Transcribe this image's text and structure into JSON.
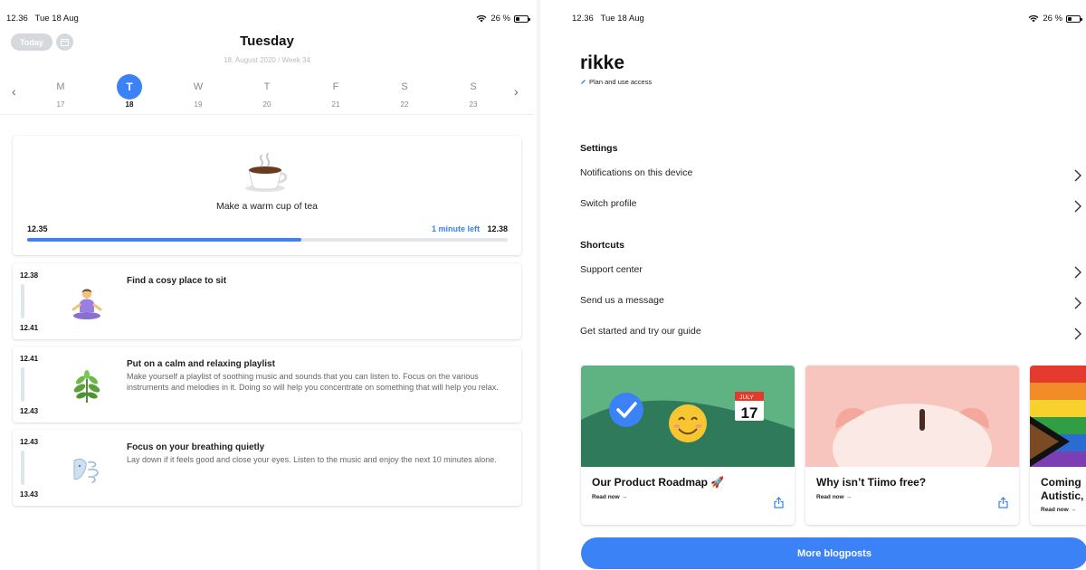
{
  "status_left": {
    "time": "12.36",
    "date": "Tue 18 Aug",
    "battery": "26 %"
  },
  "status_right": {
    "time": "12.36",
    "date": "Tue 18 Aug",
    "battery": "26 %"
  },
  "calendar": {
    "today_label": "Today",
    "day_title": "Tuesday",
    "day_subtitle": "18. August 2020 / Week 34",
    "week": [
      {
        "letter": "M",
        "num": "17"
      },
      {
        "letter": "T",
        "num": "18"
      },
      {
        "letter": "W",
        "num": "19"
      },
      {
        "letter": "T",
        "num": "20"
      },
      {
        "letter": "F",
        "num": "21"
      },
      {
        "letter": "S",
        "num": "22"
      },
      {
        "letter": "S",
        "num": "23"
      }
    ],
    "selected_index": 1
  },
  "current_activity": {
    "icon": "hot-beverage-icon",
    "title": "Make a warm cup of tea",
    "start": "12.35",
    "time_left": "1 minute left",
    "end": "12.38",
    "progress": 0.57
  },
  "activities": [
    {
      "start": "12.38",
      "end": "12.41",
      "icon": "meditation-icon",
      "title": "Find a cosy place to sit",
      "description": ""
    },
    {
      "start": "12.41",
      "end": "12.43",
      "icon": "herb-icon",
      "title": "Put on a calm and relaxing playlist",
      "description": "Make yourself a playlist of soothing music and sounds that you can listen to. Focus on the various instruments and melodies in it. Doing so will help you concentrate on something that will help you relax."
    },
    {
      "start": "12.43",
      "end": "13.43",
      "icon": "wind-face-icon",
      "title": "Focus on your breathing quietly",
      "description": "Lay down if it feels good and close your eyes. Listen to the music and enjoy the next 10 minutes alone."
    }
  ],
  "profile": {
    "name": "rikke",
    "subtitle": "Plan and use access"
  },
  "settings": {
    "title": "Settings",
    "items": [
      "Notifications on this device",
      "Switch profile"
    ]
  },
  "shortcuts": {
    "title": "Shortcuts",
    "items": [
      "Support center",
      "Send us a message",
      "Get started and try our guide"
    ]
  },
  "blog": {
    "posts": [
      {
        "title": "Our Product Roadmap 🚀",
        "read": "Read now →",
        "calendar_month": "JULY",
        "calendar_day": "17"
      },
      {
        "title": "Why isn’t Tiimo free?",
        "read": "Read now →"
      },
      {
        "title_line1": "Coming",
        "title_line2": "Autistic,",
        "read": "Read now →"
      }
    ],
    "more_label": "More blogposts"
  },
  "colors": {
    "accent": "#3b82f6",
    "roadmap_green": "#5fb382",
    "piggy_pink": "#f7c5bd"
  }
}
